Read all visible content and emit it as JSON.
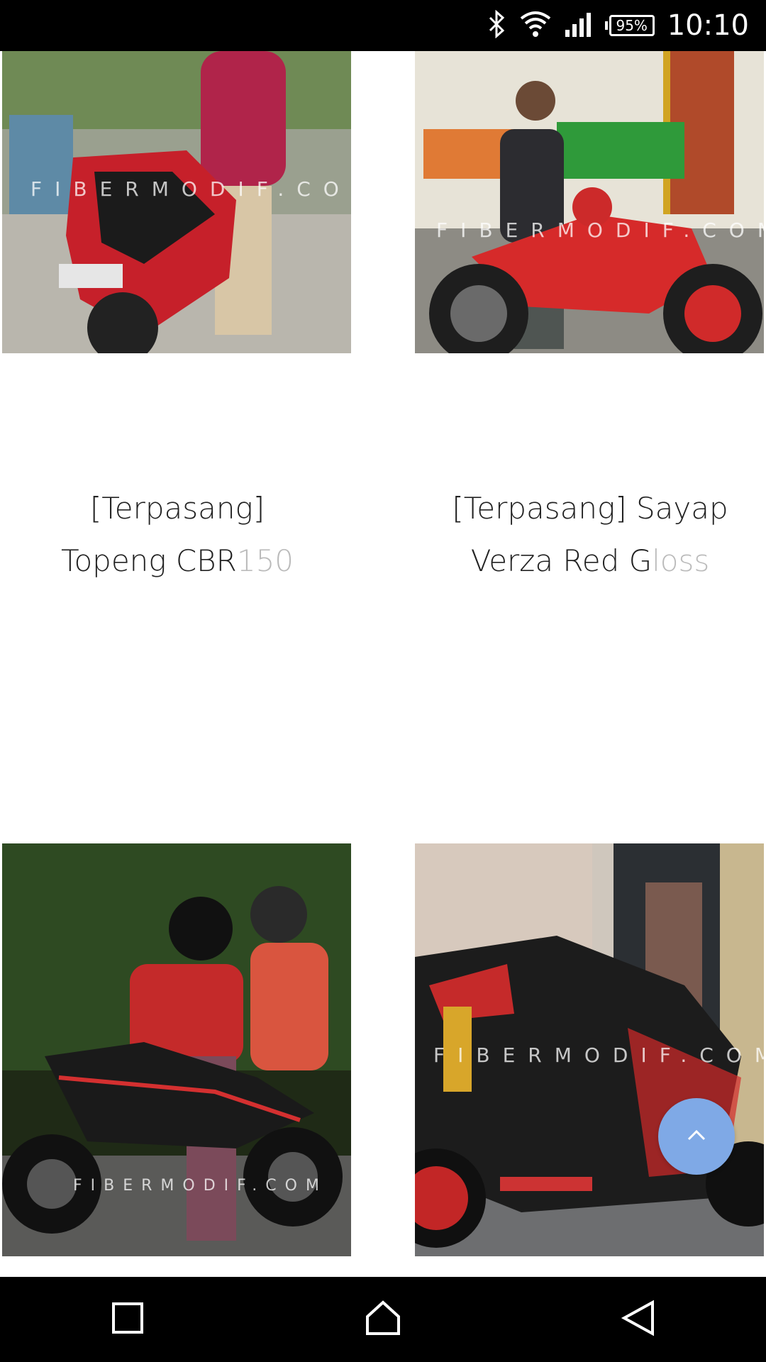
{
  "status_bar": {
    "battery_percent": "95%",
    "time": "10:10",
    "icons": [
      "bluetooth-icon",
      "wifi-icon",
      "cellular-signal-icon",
      "battery-icon"
    ]
  },
  "gallery": {
    "watermark": "FIBERMODIF.COM",
    "items": [
      {
        "title_line1": "[Terpasang]",
        "title_line2_main": "Topeng CBR",
        "title_line2_faded": "150"
      },
      {
        "title_line1": "[Terpasang] Sayap",
        "title_line2_main": "Verza Red G",
        "title_line2_faded": "loss"
      }
    ]
  },
  "scroll_top_button": {
    "icon": "chevron-up-icon"
  },
  "nav_bar": {
    "icons": [
      "recent-apps-icon",
      "home-icon",
      "back-icon"
    ]
  }
}
